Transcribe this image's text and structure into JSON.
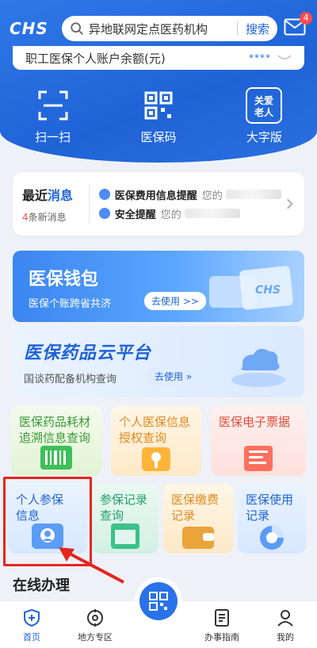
{
  "header": {
    "logo": "CHS",
    "search_placeholder": "异地联网定点医药机构",
    "search_button": "搜索",
    "mail_badge": "4"
  },
  "balance": {
    "label": "职工医保个人账户余额(元)",
    "masked": "****"
  },
  "quick_actions": [
    {
      "label": "扫一扫",
      "icon": "scan-icon"
    },
    {
      "label": "医保码",
      "icon": "qr-code-icon"
    },
    {
      "label": "大字版",
      "icon": "elderly-care-icon",
      "icon_text": "关爱\n老人"
    }
  ],
  "messages": {
    "title_prefix": "最近",
    "title_highlight": "消息",
    "count_num": "4",
    "count_suffix": "条新消息",
    "items": [
      {
        "title": "医保费用信息提醒",
        "preview": "您的"
      },
      {
        "title": "安全提醒",
        "preview": "您的"
      }
    ]
  },
  "banners": {
    "wallet": {
      "title": "医保钱包",
      "subtitle": "医保个账跨省共济",
      "cta": "去使用 >>"
    },
    "cloud": {
      "title": "医保药品云平台",
      "subtitle": "国谈药配备机构查询",
      "cta": "去使用 »"
    }
  },
  "services": [
    {
      "label_1": "医保药品耗材",
      "label_2": "追溯信息查询"
    },
    {
      "label_1": "个人医保信息",
      "label_2": "授权查询"
    },
    {
      "label_1": "医保电子票据",
      "label_2": ""
    },
    {
      "label_1": "个人参保",
      "label_2": "信息"
    },
    {
      "label_1": "参保记录",
      "label_2": "查询"
    },
    {
      "label_1": "医保缴费",
      "label_2": "记录"
    },
    {
      "label_1": "医保使用",
      "label_2": "记录"
    }
  ],
  "section_title": "在线办理",
  "nav": [
    {
      "label": "首页",
      "icon": "home-shield-icon"
    },
    {
      "label": "地方专区",
      "icon": "location-target-icon"
    },
    {
      "label": "",
      "icon": "center-qr-icon"
    },
    {
      "label": "办事指南",
      "icon": "guide-document-icon"
    },
    {
      "label": "我的",
      "icon": "user-profile-icon"
    }
  ],
  "colors": {
    "primary": "#1f63d6",
    "highlight_box": "#e3261e",
    "badge": "#ff4d4f"
  }
}
